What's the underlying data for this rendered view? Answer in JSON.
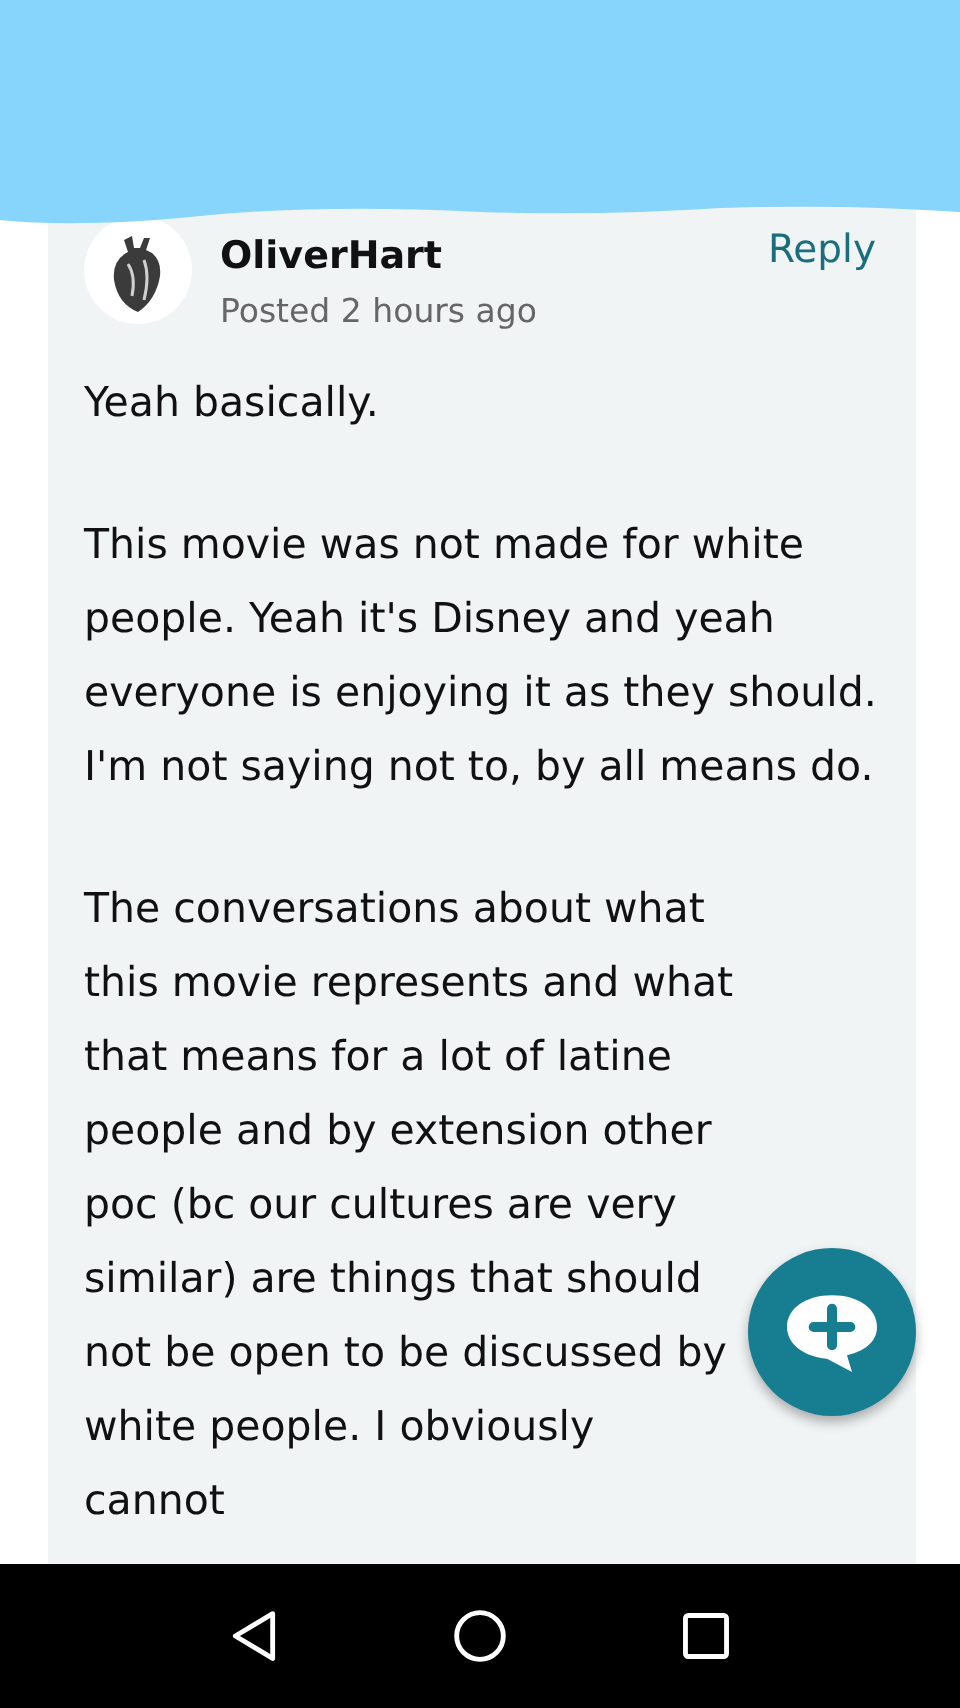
{
  "comment": {
    "author": "OliverHart",
    "posted": "Posted 2 hours ago",
    "reply": "Reply",
    "paragraphs": [
      "Yeah basically.",
      "This movie was not made for white people. Yeah it's Disney and yeah everyone is enjoying it as they should. I'm not saying not to, by all means do.",
      "The conversations about what this movie represents and what that means for a lot of latine people and by extension other poc (bc our cultures are very similar) are things that should not be open to be discussed by white people. I obviously cannot"
    ]
  }
}
